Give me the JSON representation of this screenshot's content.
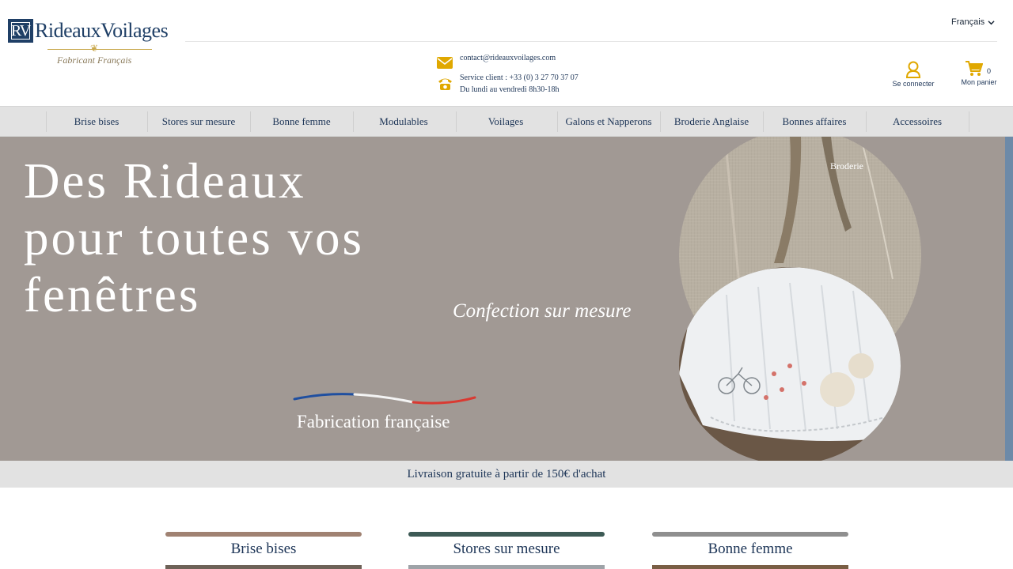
{
  "brand": {
    "logo_initials": "RV",
    "logo_name": "RideauxVoilages",
    "logo_tagline": "Fabricant Français",
    "gold": "#c9a84c",
    "navy": "#1f3f66"
  },
  "header": {
    "language": "Français",
    "email": "contact@rideauxvoilages.com",
    "phone": "Service client : +33 (0) 3 27 70 37 07",
    "hours": "Du lundi au vendredi 8h30-18h",
    "account_label": "Se connecter",
    "cart_label": "Mon panier",
    "cart_count": "0",
    "icon_color": "#e0a800"
  },
  "nav": {
    "items": [
      "Brise bises",
      "Stores sur mesure",
      "Bonne femme",
      "Modulables",
      "Voilages",
      "Galons et Napperons",
      "Broderie Anglaise",
      "Bonnes affaires",
      "Accessoires"
    ]
  },
  "hero": {
    "title_line1": "Des Rideaux",
    "title_line2": "pour toutes vos",
    "title_line3": "fenêtres",
    "subtitle": "Confection sur mesure",
    "made_in": "Fabrication française",
    "image_alt": "Broderie",
    "background": "#a19994"
  },
  "shipping": {
    "text": "Livraison gratuite à partir de 150€ d'achat"
  },
  "categories": [
    {
      "title": "Brise bises",
      "color": "#a08272"
    },
    {
      "title": "Stores sur mesure",
      "color": "#3d5a55"
    },
    {
      "title": "Bonne femme",
      "color": "#8f8f8f"
    }
  ]
}
